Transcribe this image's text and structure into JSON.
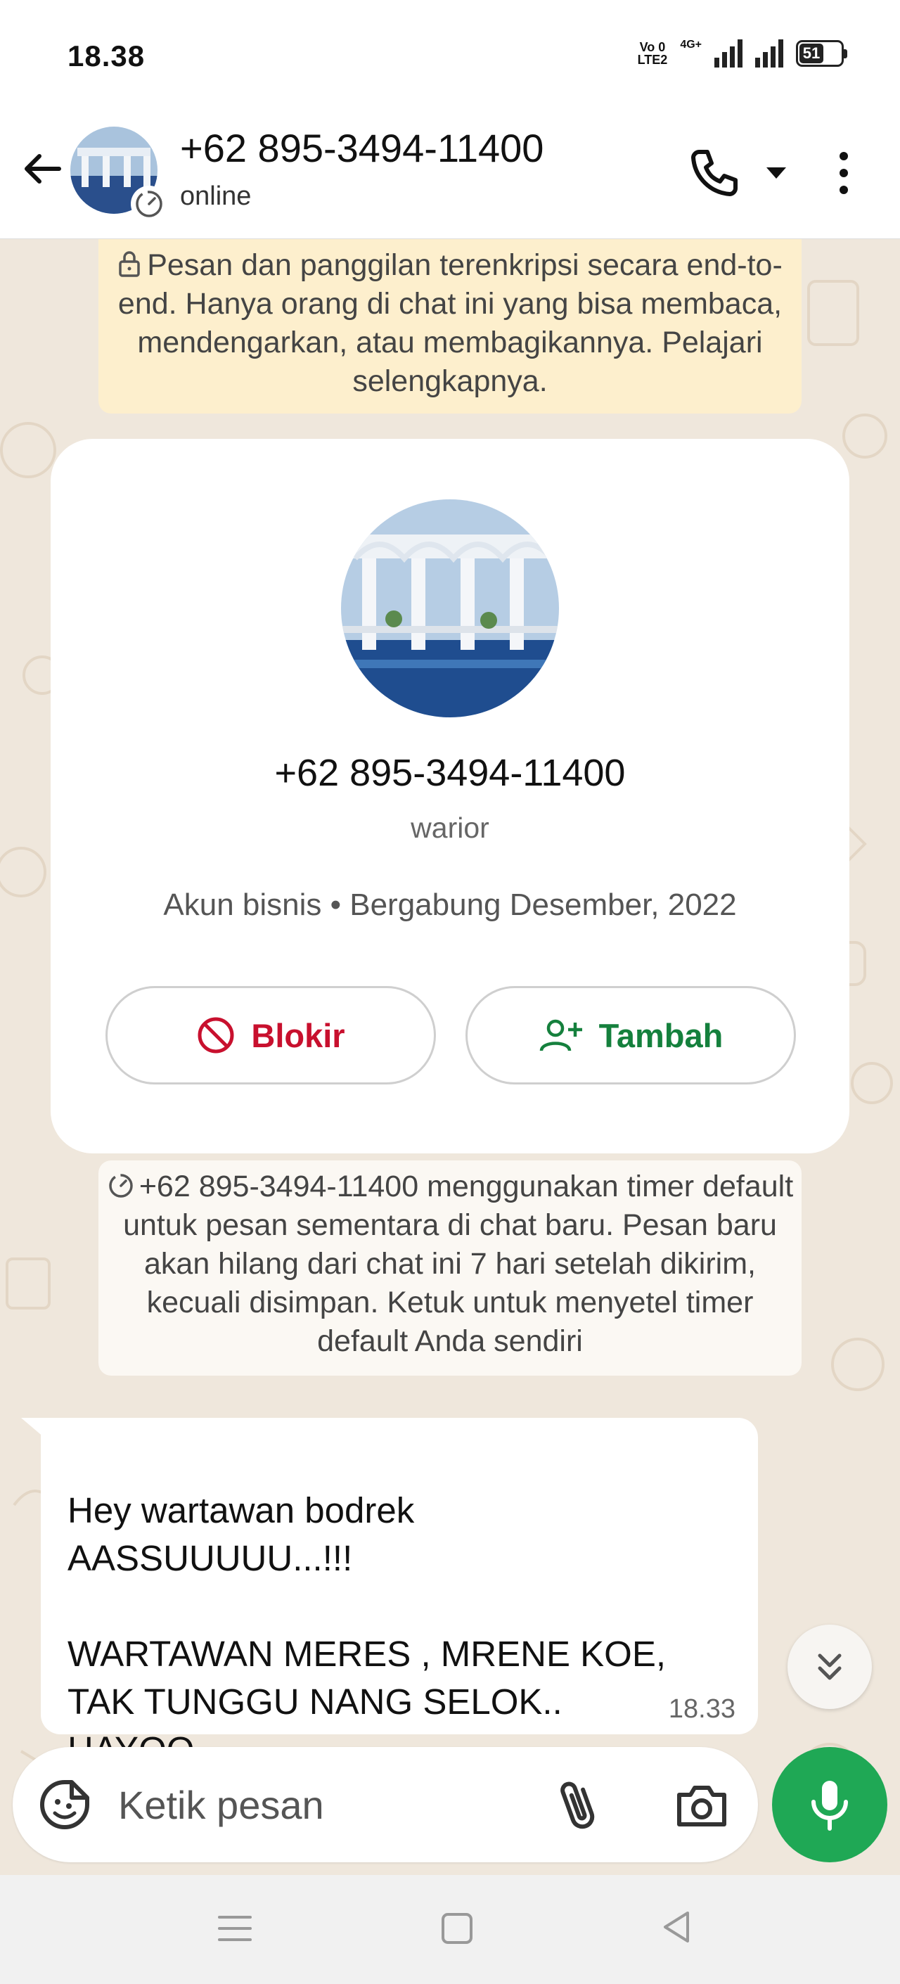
{
  "status_bar": {
    "time": "18.38",
    "volte_top": "Vo 0",
    "volte_bottom": "LTE2",
    "network": "4G+",
    "battery": "51"
  },
  "header": {
    "name": "+62 895-3494-11400",
    "status": "online"
  },
  "encryption_notice": "Pesan dan panggilan terenkripsi secara end-to-end. Hanya orang di chat ini yang bisa membaca, mendengarkan, atau membagikannya. Pelajari selengkapnya.",
  "profile": {
    "number": "+62 895-3494-11400",
    "name": "warior",
    "meta": "Akun bisnis • Bergabung Desember, 2022",
    "block_label": "Blokir",
    "add_label": "Tambah"
  },
  "timer_notice": "+62 895-3494-11400 menggunakan timer default untuk pesan sementara di chat baru. Pesan baru akan hilang dari chat ini 7 hari setelah dikirim, kecuali disimpan. Ketuk untuk menyetel timer default Anda sendiri",
  "message": {
    "text": "Hey wartawan bodrek\nAASSUUUUU...!!!\n\nWARTAWAN MERES , MRENE KOE,\nTAK TUNGGU NANG SELOK..\nHAYOO..",
    "time": "18.33"
  },
  "composer": {
    "placeholder": "Ketik pesan"
  },
  "colors": {
    "accent_green": "#1fa855",
    "block_red": "#c8102e",
    "add_green": "#15803d",
    "notice_yellow": "#fdefcd"
  },
  "icons": [
    "back-arrow-icon",
    "timer-icon",
    "phone-icon",
    "caret-down-icon",
    "more-vert-icon",
    "lock-icon",
    "block-icon",
    "add-person-icon",
    "double-chevron-down-icon",
    "sticker-icon",
    "paperclip-icon",
    "camera-icon",
    "mic-icon",
    "menu-icon",
    "home-square-icon",
    "back-triangle-icon"
  ]
}
